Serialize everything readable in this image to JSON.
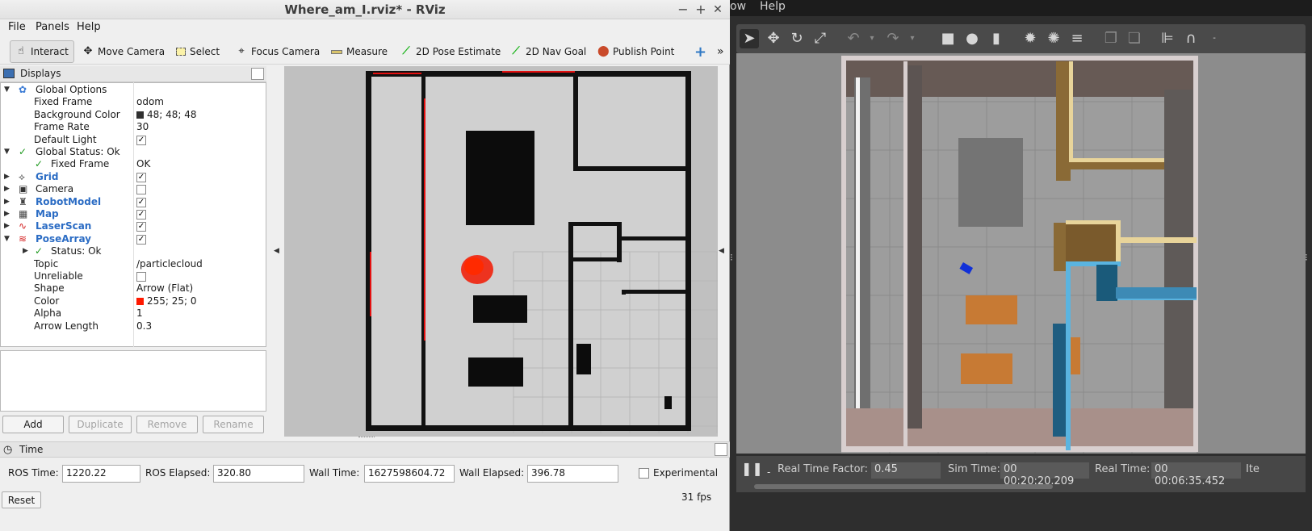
{
  "window": {
    "title": "Where_am_I.rviz* - RViz",
    "minimize": "−",
    "maximize": "+",
    "close": "✕"
  },
  "menu": {
    "file": "File",
    "panels": "Panels",
    "help": "Help"
  },
  "toolbar": {
    "interact": "Interact",
    "move_camera": "Move Camera",
    "select": "Select",
    "focus_camera": "Focus Camera",
    "measure": "Measure",
    "pose_estimate": "2D Pose Estimate",
    "nav_goal": "2D Nav Goal",
    "publish_point": "Publish Point",
    "more": "»"
  },
  "displays": {
    "title": "Displays",
    "global_options": "Global Options",
    "fixed_frame_k": "Fixed Frame",
    "fixed_frame_v": "odom",
    "bg_color_k": "Background Color",
    "bg_color_v": "48; 48; 48",
    "frame_rate_k": "Frame Rate",
    "frame_rate_v": "30",
    "default_light_k": "Default Light",
    "global_status": "Global Status: Ok",
    "gs_fixed_frame_k": "Fixed Frame",
    "gs_fixed_frame_v": "OK",
    "grid": "Grid",
    "camera": "Camera",
    "robot_model": "RobotModel",
    "map": "Map",
    "laser_scan": "LaserScan",
    "pose_array": "PoseArray",
    "status_ok": "Status: Ok",
    "topic_k": "Topic",
    "topic_v": "/particlecloud",
    "unreliable_k": "Unreliable",
    "shape_k": "Shape",
    "shape_v": "Arrow (Flat)",
    "color_k": "Color",
    "color_v": "255; 25; 0",
    "alpha_k": "Alpha",
    "alpha_v": "1",
    "arrow_length_k": "Arrow Length",
    "arrow_length_v": "0.3"
  },
  "panel_buttons": {
    "add": "Add",
    "duplicate": "Duplicate",
    "remove": "Remove",
    "rename": "Rename"
  },
  "time_panel": {
    "title": "Time",
    "ros_time_label": "ROS Time:",
    "ros_time": "1220.22",
    "ros_elapsed_label": "ROS Elapsed:",
    "ros_elapsed": "320.80",
    "wall_time_label": "Wall Time:",
    "wall_time": "1627598604.72",
    "wall_elapsed_label": "Wall Elapsed:",
    "wall_elapsed": "396.78",
    "experimental": "Experimental",
    "reset": "Reset",
    "fps": "31 fps"
  },
  "gazebo": {
    "menu_ow": "ow",
    "menu_help": "Help",
    "rtf_label": "Real Time Factor:",
    "rtf": "0.45",
    "sim_time_label": "Sim Time:",
    "sim_time": "00 00:20:20.209",
    "real_time_label": "Real Time:",
    "real_time": "00 00:06:35.452",
    "iter_label": "Ite"
  },
  "colors": {
    "bg_swatch": "#303030",
    "particle_swatch": "#ff1900",
    "accent_blue": "#2b6cc4"
  }
}
